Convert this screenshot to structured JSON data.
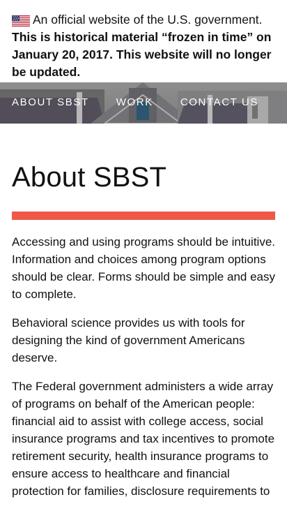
{
  "gov_banner": {
    "official_text": "An official website of the U.S. government.",
    "historical_notice": "This is historical material “frozen in time” on January 20, 2017. This website will no longer be updated.",
    "flag_icon": "us-flag-icon"
  },
  "nav": {
    "items": [
      {
        "label": "ABOUT SBST"
      },
      {
        "label": "WORK"
      },
      {
        "label": "CONTACT US"
      }
    ]
  },
  "main": {
    "title": "About SBST",
    "accent_color": "#ee5a46",
    "paragraphs": [
      "Accessing and using programs should be intuitive. Information and choices among program options should be clear. Forms should be simple and easy to complete.",
      "Behavioral science provides us with tools for designing the kind of government Americans deserve.",
      "The Federal government administers a wide array of programs on behalf of the American people: financial aid to assist with college access, social insurance programs and tax incentives to promote retirement security, health insurance programs to ensure access to healthcare and financial protection for families, disclosure requirements to"
    ]
  }
}
